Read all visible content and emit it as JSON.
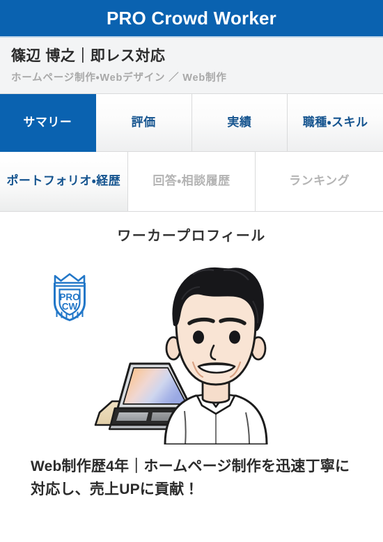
{
  "header": {
    "brand": "PRO Crowd Worker",
    "brand_bg_color": "#0a62b0",
    "brand_text_color": "#ffffff"
  },
  "worker": {
    "name": "篠辺 博之｜即レス対応",
    "category": "ホームページ制作・Webデザイン ／ Web制作"
  },
  "tabs": {
    "row1": [
      {
        "label": "サマリー",
        "state": "active"
      },
      {
        "label": "評価",
        "state": "link"
      },
      {
        "label": "実績",
        "state": "link"
      },
      {
        "label": "職種・スキル",
        "state": "link"
      }
    ],
    "row2": [
      {
        "label": "ポートフォリオ・経歴",
        "state": "link"
      },
      {
        "label": "回答・相談履歴",
        "state": "disabled"
      },
      {
        "label": "ランキング",
        "state": "disabled"
      }
    ]
  },
  "profile": {
    "section_title": "ワーカープロフィール",
    "badge": {
      "line1": "PRO",
      "line2": "CW",
      "color": "#2277c8"
    },
    "avatar_alt": "ノートパソコンの前に座る白いシャツの男性のイラスト",
    "tagline": "Web制作歴4年｜ホームページ制作を迅速丁寧に対応し、売上UPに貢献！"
  },
  "colors": {
    "accent_blue": "#0a62b0",
    "tab_link_text": "#15548f",
    "muted_text": "#a8a8a8",
    "panel_bg": "#f3f4f5",
    "border": "#d9dadb"
  }
}
